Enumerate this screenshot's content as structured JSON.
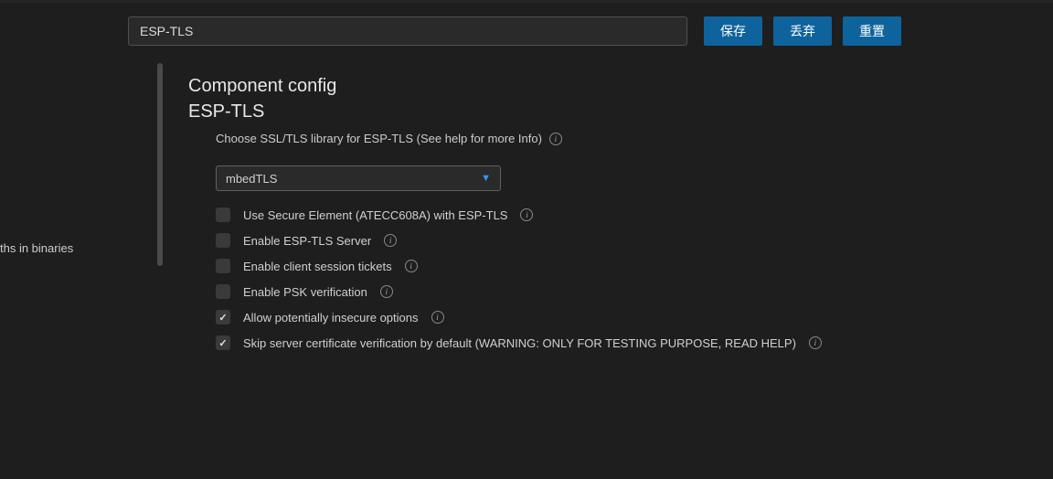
{
  "search": {
    "value": "ESP-TLS"
  },
  "buttons": {
    "save": "保存",
    "discard": "丢弃",
    "reset": "重置"
  },
  "sidebar": {
    "item0": "ths in binaries"
  },
  "header": {
    "title1": "Component config",
    "title2": "ESP-TLS"
  },
  "desc": "Choose SSL/TLS library for ESP-TLS (See help for more Info)",
  "select": {
    "value": "mbedTLS"
  },
  "options": [
    {
      "label": "Use Secure Element (ATECC608A) with ESP-TLS",
      "checked": false,
      "info": true
    },
    {
      "label": "Enable ESP-TLS Server",
      "checked": false,
      "info": true
    },
    {
      "label": "Enable client session tickets",
      "checked": false,
      "info": true
    },
    {
      "label": "Enable PSK verification",
      "checked": false,
      "info": true
    },
    {
      "label": "Allow potentially insecure options",
      "checked": true,
      "info": true
    },
    {
      "label": "Skip server certificate verification by default (WARNING: ONLY FOR TESTING PURPOSE, READ HELP)",
      "checked": true,
      "info": true
    }
  ]
}
